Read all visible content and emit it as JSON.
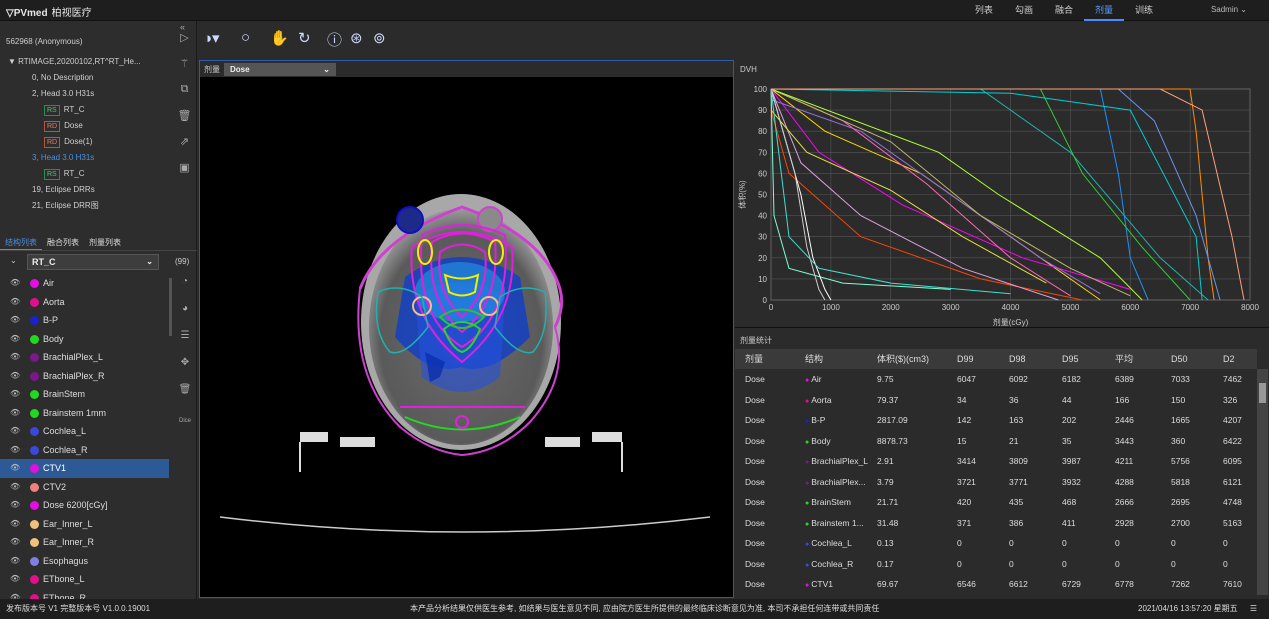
{
  "app": {
    "logo": "PVmed",
    "logo_sub": "柏视医疗",
    "nav": [
      "列表",
      "勾画",
      "融合",
      "剂量",
      "训练"
    ],
    "active_nav": "剂量",
    "user": "Sadmin"
  },
  "patient": "562968 (Anonymous)",
  "tree": [
    {
      "text": "RTIMAGE,20200102,RT^RT_He...",
      "indent": 8,
      "prefix": "▼"
    },
    {
      "text": "0, No Description",
      "indent": 32
    },
    {
      "text": "2, Head 3.0 H31s",
      "indent": 32
    },
    {
      "text": "RT_C",
      "indent": 44,
      "tag": "RS"
    },
    {
      "text": "Dose",
      "indent": 44,
      "tag": "RD"
    },
    {
      "text": "Dose(1)",
      "indent": 44,
      "tag": "RD"
    },
    {
      "text": "3, Head 3.0 H31s",
      "indent": 32,
      "color": "#4a90e2"
    },
    {
      "text": "RT_C",
      "indent": 44,
      "tag": "RS"
    },
    {
      "text": "19, Eclipse DRRs",
      "indent": 32
    },
    {
      "text": "21, Eclipse DRR图",
      "indent": 32
    }
  ],
  "tabs": [
    "结构列表",
    "融合列表",
    "剂量列表"
  ],
  "structure_set": {
    "name": "RT_C",
    "count": "(99)"
  },
  "structures": [
    {
      "name": "Air",
      "color": "#e010e0"
    },
    {
      "name": "Aorta",
      "color": "#e0108a"
    },
    {
      "name": "B-P",
      "color": "#1a22c8"
    },
    {
      "name": "Body",
      "color": "#22d822"
    },
    {
      "name": "BrachialPlex_L",
      "color": "#7a1a8a"
    },
    {
      "name": "BrachialPlex_R",
      "color": "#7a1a8a"
    },
    {
      "name": "BrainStem",
      "color": "#22d822"
    },
    {
      "name": "Brainstem 1mm",
      "color": "#22d822"
    },
    {
      "name": "Cochlea_L",
      "color": "#3a4ad8"
    },
    {
      "name": "Cochlea_R",
      "color": "#3a4ad8"
    },
    {
      "name": "CTV1",
      "color": "#e010e0",
      "selected": true
    },
    {
      "name": "CTV2",
      "color": "#f08080"
    },
    {
      "name": "Dose 6200[cGy]",
      "color": "#e010e0"
    },
    {
      "name": "Ear_Inner_L",
      "color": "#f0c080"
    },
    {
      "name": "Ear_Inner_R",
      "color": "#f0c080"
    },
    {
      "name": "Esophagus",
      "color": "#8080e0"
    },
    {
      "name": "ETbone_L",
      "color": "#e0108a"
    },
    {
      "name": "ETbone_R",
      "color": "#e0108a"
    }
  ],
  "image_pane": {
    "label": "剂量",
    "dose_select": "Dose"
  },
  "dvh": {
    "title": "DVH"
  },
  "chart_data": {
    "type": "line",
    "title": "",
    "xlabel": "剂量(cGy)",
    "ylabel": "体积(%)",
    "xlim": [
      0,
      8000
    ],
    "ylim": [
      0,
      100
    ],
    "xticks": [
      0,
      1000,
      2000,
      3000,
      4000,
      5000,
      6000,
      7000,
      8000
    ],
    "yticks": [
      0,
      10,
      20,
      30,
      40,
      50,
      60,
      70,
      80,
      90,
      100
    ],
    "grid": true,
    "series": [
      {
        "color": "#ff8c00",
        "x": [
          0,
          7000,
          7100,
          7300,
          7400
        ],
        "y": [
          100,
          100,
          80,
          20,
          0
        ]
      },
      {
        "color": "#1e90ff",
        "x": [
          0,
          5500,
          5800,
          6000,
          6300
        ],
        "y": [
          100,
          100,
          60,
          20,
          0
        ]
      },
      {
        "color": "#20b2aa",
        "x": [
          0,
          3500,
          5000,
          6500,
          7300
        ],
        "y": [
          100,
          100,
          70,
          20,
          0
        ]
      },
      {
        "color": "#32cd32",
        "x": [
          0,
          4500,
          5200,
          6200,
          7000
        ],
        "y": [
          100,
          100,
          60,
          25,
          0
        ]
      },
      {
        "color": "#ffd700",
        "x": [
          0,
          900,
          2500,
          4000,
          5500
        ],
        "y": [
          100,
          80,
          60,
          30,
          0
        ]
      },
      {
        "color": "#ff00ff",
        "x": [
          0,
          800,
          2200,
          4200,
          6000
        ],
        "y": [
          100,
          70,
          45,
          20,
          5
        ]
      },
      {
        "color": "#9370db",
        "x": [
          0,
          1500,
          3000,
          4500,
          5500
        ],
        "y": [
          95,
          80,
          50,
          20,
          3
        ]
      },
      {
        "color": "#ff69b4",
        "x": [
          0,
          1200,
          2600,
          4000,
          5000
        ],
        "y": [
          100,
          85,
          55,
          20,
          2
        ]
      },
      {
        "color": "#00ced1",
        "x": [
          0,
          4000,
          6000,
          7100,
          7200
        ],
        "y": [
          100,
          98,
          90,
          30,
          0
        ]
      },
      {
        "color": "#bdb76b",
        "x": [
          0,
          2000,
          3500,
          5000,
          6000
        ],
        "y": [
          100,
          75,
          40,
          15,
          2
        ]
      },
      {
        "color": "#ff4500",
        "x": [
          0,
          300,
          1500,
          3500,
          5200
        ],
        "y": [
          90,
          60,
          30,
          10,
          0
        ]
      },
      {
        "color": "#dda0dd",
        "x": [
          0,
          500,
          1500,
          3200,
          4800
        ],
        "y": [
          100,
          65,
          40,
          15,
          0
        ]
      },
      {
        "color": "#7fffd4",
        "x": [
          0,
          50,
          300,
          1200,
          3000
        ],
        "y": [
          100,
          40,
          15,
          8,
          5
        ]
      },
      {
        "color": "#ffffff",
        "x": [
          0,
          500,
          700,
          900,
          1000
        ],
        "y": [
          100,
          50,
          20,
          5,
          0
        ]
      },
      {
        "color": "#cccccc",
        "x": [
          0,
          400,
          600,
          800,
          900
        ],
        "y": [
          100,
          60,
          25,
          5,
          0
        ]
      },
      {
        "color": "#adff2f",
        "x": [
          0,
          2800,
          3800,
          5500,
          6200
        ],
        "y": [
          100,
          70,
          50,
          20,
          0
        ]
      },
      {
        "color": "#6495ed",
        "x": [
          0,
          5800,
          6400,
          7100,
          7500
        ],
        "y": [
          100,
          100,
          85,
          40,
          0
        ]
      },
      {
        "color": "#ffa07a",
        "x": [
          0,
          6500,
          7200,
          7700,
          7900
        ],
        "y": [
          100,
          100,
          90,
          30,
          0
        ]
      },
      {
        "color": "#e0e040",
        "x": [
          0,
          600,
          2000,
          3200,
          4600
        ],
        "y": [
          90,
          70,
          52,
          30,
          8
        ]
      },
      {
        "color": "#40e0d0",
        "x": [
          0,
          300,
          800,
          2000,
          4000
        ],
        "y": [
          100,
          30,
          15,
          8,
          3
        ]
      }
    ]
  },
  "stats": {
    "title": "剂量统计",
    "columns": [
      "剂量",
      "结构",
      "体积($)(cm3)",
      "D99",
      "D98",
      "D95",
      "平均",
      "D50",
      "D2"
    ],
    "rows": [
      {
        "dose": "Dose",
        "structure": "Air",
        "color": "#e010e0",
        "volume": "9.75",
        "d99": "6047",
        "d98": "6092",
        "d95": "6182",
        "mean": "6389",
        "d50": "7033",
        "d2": "7462"
      },
      {
        "dose": "Dose",
        "structure": "Aorta",
        "color": "#e0108a",
        "volume": "79.37",
        "d99": "34",
        "d98": "36",
        "d95": "44",
        "mean": "166",
        "d50": "150",
        "d2": "326"
      },
      {
        "dose": "Dose",
        "structure": "B-P",
        "color": "#1a22c8",
        "volume": "2817.09",
        "d99": "142",
        "d98": "163",
        "d95": "202",
        "mean": "2446",
        "d50": "1665",
        "d2": "4207"
      },
      {
        "dose": "Dose",
        "structure": "Body",
        "color": "#22d822",
        "volume": "8878.73",
        "d99": "15",
        "d98": "21",
        "d95": "35",
        "mean": "3443",
        "d50": "360",
        "d2": "6422"
      },
      {
        "dose": "Dose",
        "structure": "BrachialPlex_L",
        "color": "#7a1a8a",
        "volume": "2.91",
        "d99": "3414",
        "d98": "3809",
        "d95": "3987",
        "mean": "4211",
        "d50": "5756",
        "d2": "6095"
      },
      {
        "dose": "Dose",
        "structure": "BrachialPlex...",
        "color": "#7a1a8a",
        "volume": "3.79",
        "d99": "3721",
        "d98": "3771",
        "d95": "3932",
        "mean": "4288",
        "d50": "5818",
        "d2": "6121"
      },
      {
        "dose": "Dose",
        "structure": "BrainStem",
        "color": "#22d822",
        "volume": "21.71",
        "d99": "420",
        "d98": "435",
        "d95": "468",
        "mean": "2666",
        "d50": "2695",
        "d2": "4748"
      },
      {
        "dose": "Dose",
        "structure": "Brainstem 1...",
        "color": "#22d822",
        "volume": "31.48",
        "d99": "371",
        "d98": "386",
        "d95": "411",
        "mean": "2928",
        "d50": "2700",
        "d2": "5163"
      },
      {
        "dose": "Dose",
        "structure": "Cochlea_L",
        "color": "#3a4ad8",
        "volume": "0.13",
        "d99": "0",
        "d98": "0",
        "d95": "0",
        "mean": "0",
        "d50": "0",
        "d2": "0"
      },
      {
        "dose": "Dose",
        "structure": "Cochlea_R",
        "color": "#3a4ad8",
        "volume": "0.17",
        "d99": "0",
        "d98": "0",
        "d95": "0",
        "mean": "0",
        "d50": "0",
        "d2": "0"
      },
      {
        "dose": "Dose",
        "structure": "CTV1",
        "color": "#e010e0",
        "volume": "69.67",
        "d99": "6546",
        "d98": "6612",
        "d95": "6729",
        "mean": "6778",
        "d50": "7262",
        "d2": "7610"
      }
    ]
  },
  "footer": {
    "version": "发布版本号 V1 完整版本号 V1.0.0.19001",
    "notice": "本产品分析结果仅供医生参考, 如结果与医生意见不同, 应由院方医生所提供的最终临床诊断意见为准, 本司不承担任何连带或共同责任",
    "datetime": "2021/04/16 13:57:20 星期五"
  }
}
